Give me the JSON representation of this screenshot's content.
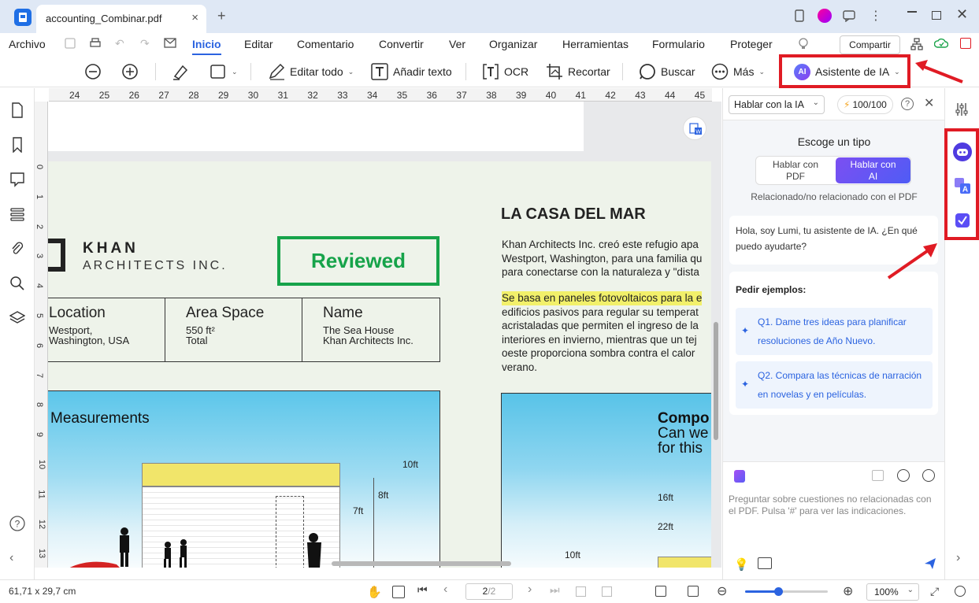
{
  "window": {
    "tab_title": "accounting_Combinar.pdf",
    "tab_close": "×",
    "new_tab": "+"
  },
  "menu": {
    "archivo": "Archivo",
    "items": [
      "Inicio",
      "Editar",
      "Comentario",
      "Convertir",
      "Ver",
      "Organizar",
      "Herramientas",
      "Formulario",
      "Proteger"
    ],
    "share": "Compartir"
  },
  "toolbar": {
    "edit_all": "Editar todo",
    "add_text": "Añadir texto",
    "ocr": "OCR",
    "crop": "Recortar",
    "search": "Buscar",
    "more": "Más",
    "ai_assistant": "Asistente de IA",
    "ai_badge": "AI"
  },
  "ruler": {
    "top": [
      "24",
      "25",
      "26",
      "27",
      "28",
      "29",
      "30",
      "31",
      "32",
      "33",
      "34",
      "35",
      "36",
      "37",
      "38",
      "39",
      "40",
      "41",
      "42",
      "43",
      "44",
      "45"
    ],
    "left": [
      "0",
      "1",
      "2",
      "3",
      "4",
      "5",
      "6",
      "7",
      "8",
      "9",
      "10",
      "11",
      "12",
      "13"
    ]
  },
  "document": {
    "logo_line1": "KHAN",
    "logo_line2": "ARCHITECTS INC.",
    "stamp": "Reviewed",
    "info": [
      {
        "title": "Location",
        "value1": "Westport,",
        "value2": "Washington, USA"
      },
      {
        "title": "Area Space",
        "value1": "550 ft²",
        "value2": "Total"
      },
      {
        "title": "Name",
        "value1": "The Sea House",
        "value2": "Khan Architects Inc."
      }
    ],
    "measurements": "Measurements",
    "dims": [
      "10ft",
      "8ft",
      "7ft"
    ],
    "heading": "LA CASA DEL MAR",
    "para1": [
      "Khan Architects Inc. creó este refugio apa",
      "Westport, Washington, para una familia qu",
      "para conectarse con la naturaleza y \"dista"
    ],
    "para2_highlight": "Se basa en paneles fotovoltaicos para la e",
    "para2": [
      "edificios pasivos para regular su temperat",
      "acristaladas que permiten el ingreso de la",
      "interiores en invierno, mientras que un tej",
      "oeste proporciona sombra contra el calor",
      "verano."
    ],
    "right_img_title": [
      "Compo",
      "Can we",
      "for this"
    ],
    "right_img_dims": [
      "16ft",
      "22ft",
      "10ft"
    ]
  },
  "ai": {
    "mode": "Hablar con la IA",
    "quota": "100/100",
    "choose_type": "Escoge un tipo",
    "opt_pdf_1": "Hablar con",
    "opt_pdf_2": "PDF",
    "opt_ai_1": "Hablar con",
    "opt_ai_2": "AI",
    "related": "Relacionado/no relacionado con el PDF",
    "greeting": "Hola, soy Lumi, tu asistente de IA. ¿En qué puedo ayudarte?",
    "examples_title": "Pedir ejemplos:",
    "q1": "Q1. Dame tres ideas para planificar resoluciones de Año Nuevo.",
    "q2": "Q2. Compara las técnicas de narración en novelas y en películas.",
    "input_placeholder": "Preguntar sobre cuestiones no relacionadas con el PDF. Pulsa '#' para ver las indicaciones."
  },
  "status": {
    "dimensions": "61,71 x 29,7 cm",
    "page_current": "2",
    "page_total": "/2",
    "zoom": "100%"
  },
  "colors": {
    "accent": "#2b63e0",
    "annotation_red": "#e01b24",
    "stamp_green": "#16a34a",
    "ai_purple": "#6d4ff0"
  }
}
